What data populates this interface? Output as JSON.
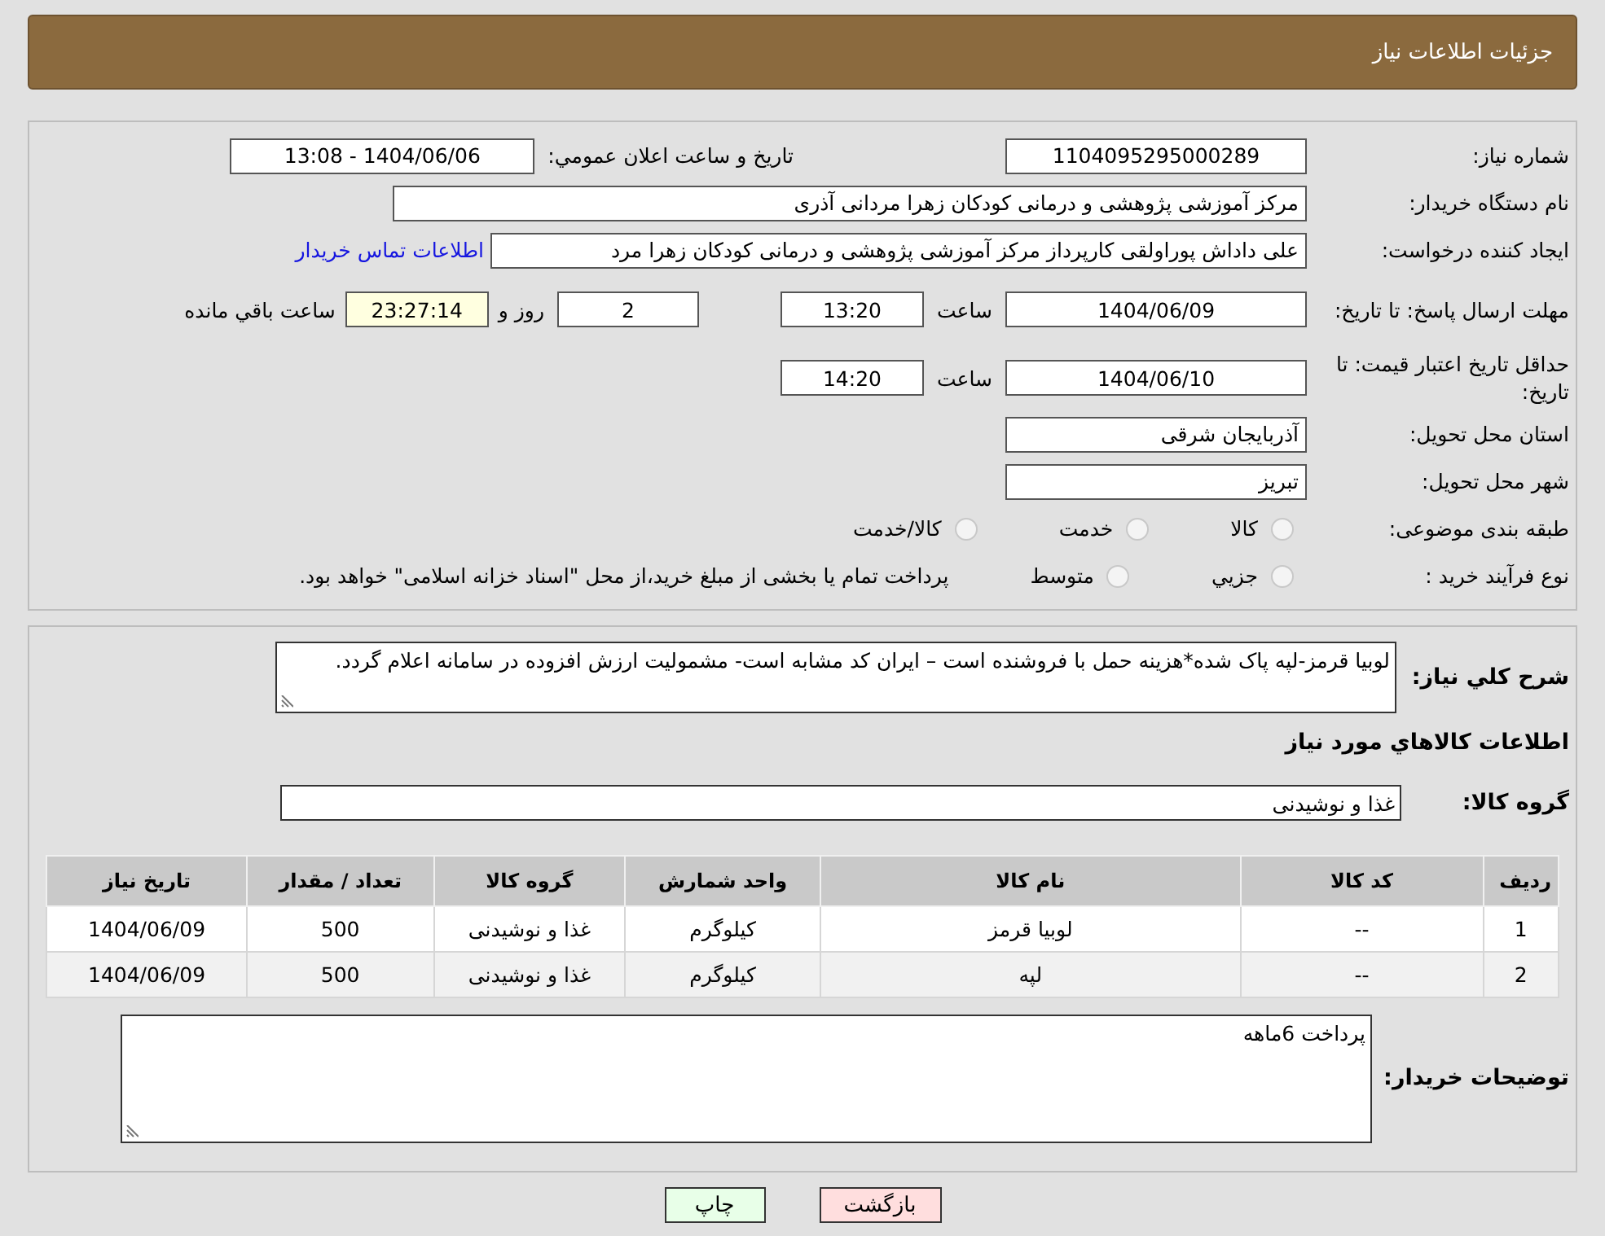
{
  "header": {
    "title": "جزئیات اطلاعات نیاز"
  },
  "details": {
    "need_number": {
      "label": "شماره نیاز:",
      "value": "1104095295000289"
    },
    "announce": {
      "label": "تاریخ و ساعت اعلان عمومي:",
      "value": "1404/06/06 - 13:08"
    },
    "buyer": {
      "label": "نام دستگاه خریدار:",
      "value": "مرکز آموزشی پژوهشی و درمانی کودکان زهرا مردانی آذری"
    },
    "requester": {
      "label": "ایجاد کننده درخواست:",
      "value": "علی داداش پوراولقی کارپرداز مرکز آموزشی پژوهشی و درمانی کودکان زهرا مرد",
      "link": "اطلاعات تماس خریدار"
    },
    "reply_deadline": {
      "label": "مهلت ارسال پاسخ: تا تاریخ:",
      "date": "1404/06/09",
      "time_label": "ساعت",
      "time": "13:20",
      "days": "2",
      "days_label": "روز و",
      "remaining": "23:27:14",
      "remaining_label": "ساعت باقي مانده"
    },
    "price_validity": {
      "label": "حداقل تاریخ اعتبار قیمت: تا تاریخ:",
      "date": "1404/06/10",
      "time_label": "ساعت",
      "time": "14:20"
    },
    "province": {
      "label": "استان محل تحویل:",
      "value": "آذربایجان شرقی"
    },
    "city": {
      "label": "شهر محل تحویل:",
      "value": "تبریز"
    },
    "category": {
      "label": "طبقه بندی موضوعی:",
      "options": [
        {
          "label": "کالا",
          "selected": false
        },
        {
          "label": "خدمت",
          "selected": false
        },
        {
          "label": "کالا/خدمت",
          "selected": false
        }
      ]
    },
    "process": {
      "label": "نوع فرآیند خرید :",
      "options": [
        {
          "label": "جزیي",
          "selected": false
        },
        {
          "label": "متوسط",
          "selected": false
        }
      ],
      "note": "پرداخت تمام یا بخشی از مبلغ خرید،از محل \"اسناد خزانه اسلامی\" خواهد بود."
    }
  },
  "goods": {
    "description": {
      "label": "شرح كلي نياز:",
      "value": "لوبیا قرمز-لپه پاک شده*هزینه حمل با فروشنده است – ایران کد مشابه است- مشمولیت ارزش افزوده در سامانه  اعلام  گردد."
    },
    "title": "اطلاعات كالاهاي مورد نياز",
    "group": {
      "label": "گروه کالا:",
      "value": "غذا و نوشیدنی"
    },
    "table": {
      "columns": [
        "رديف",
        "کد کالا",
        "نام کالا",
        "واحد شمارش",
        "گروه کالا",
        "تعداد / مقدار",
        "تاریخ نیاز"
      ],
      "rows": [
        [
          "1",
          "--",
          "لوبیا قرمز",
          "کیلوگرم",
          "غذا و نوشیدنی",
          "500",
          "1404/06/09"
        ],
        [
          "2",
          "--",
          "لپه",
          "کیلوگرم",
          "غذا و نوشیدنی",
          "500",
          "1404/06/09"
        ]
      ]
    },
    "buyer_notes": {
      "label": "توضیحات خریدار:",
      "value": "پرداخت 6ماهه"
    }
  },
  "buttons": [
    {
      "label": "بازگشت",
      "kind": "back"
    },
    {
      "label": "چاپ",
      "kind": "print"
    }
  ]
}
